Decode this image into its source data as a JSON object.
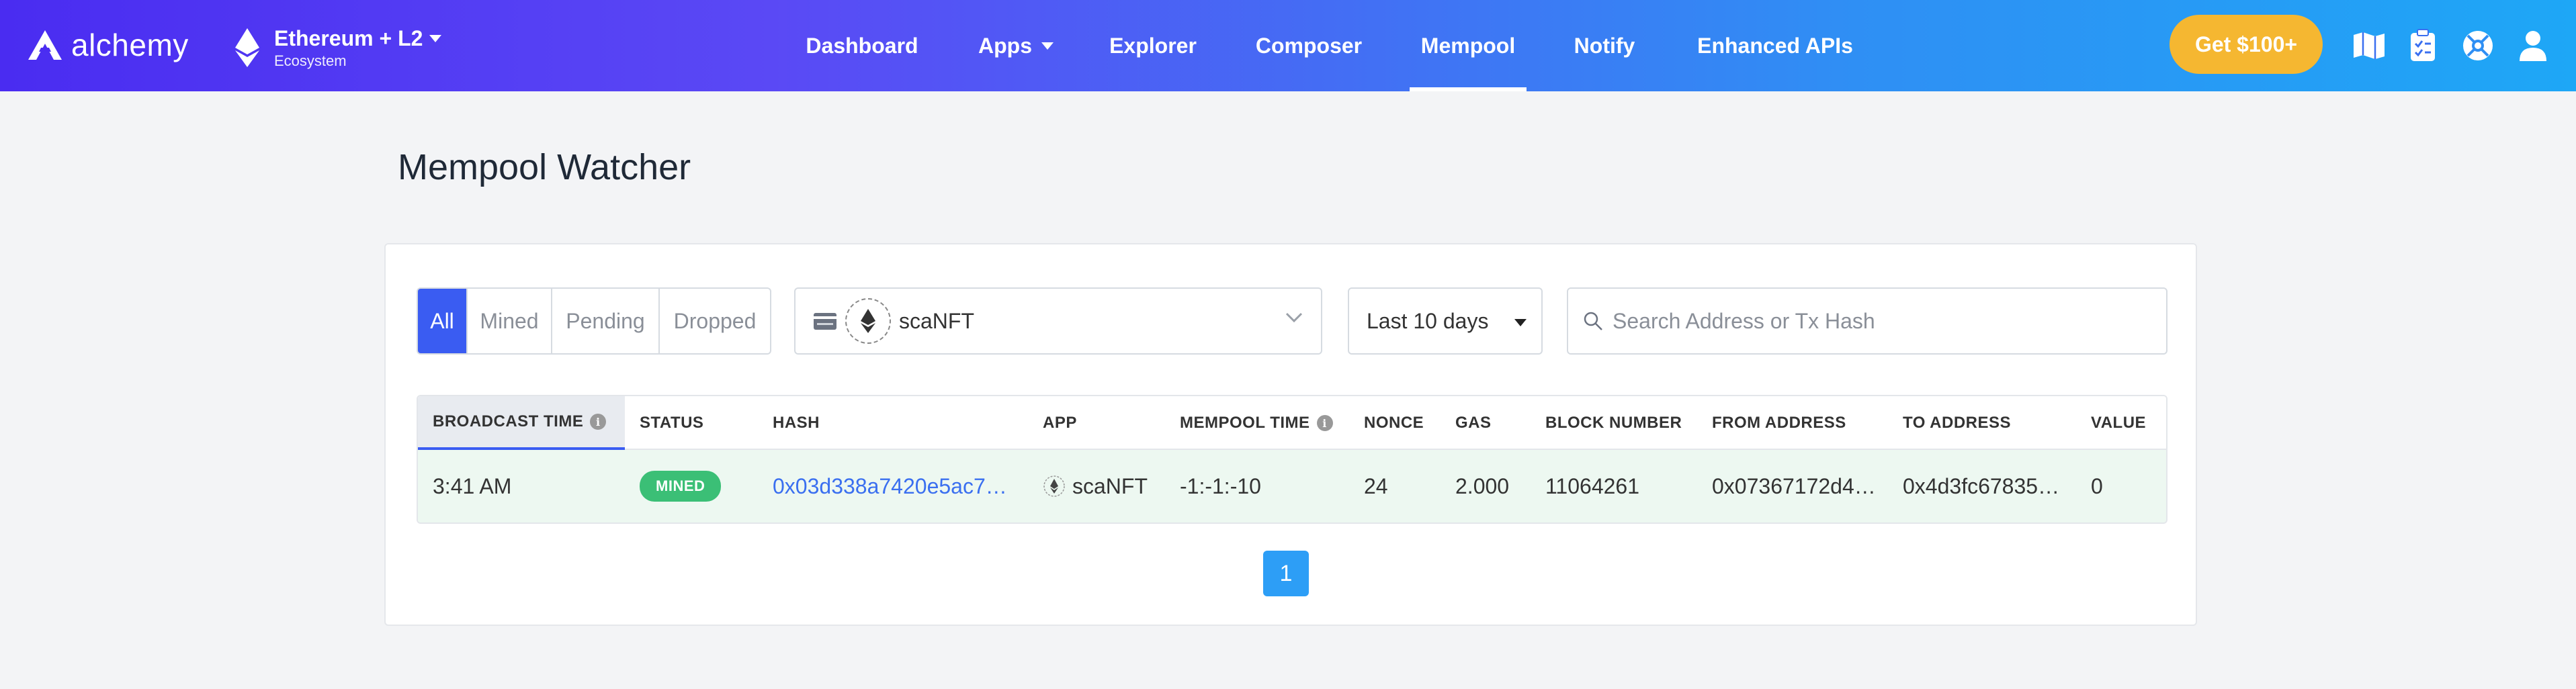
{
  "brand": {
    "name": "alchemy"
  },
  "network": {
    "name": "Ethereum + L2",
    "sub": "Ecosystem"
  },
  "nav": {
    "dashboard": "Dashboard",
    "apps": "Apps",
    "explorer": "Explorer",
    "composer": "Composer",
    "mempool": "Mempool",
    "notify": "Notify",
    "enhanced": "Enhanced APIs",
    "active": "Mempool"
  },
  "cta": {
    "label": "Get $100+"
  },
  "toolbar_icons": [
    "map-icon",
    "clipboard-icon",
    "support-icon",
    "user-icon"
  ],
  "page": {
    "title": "Mempool Watcher"
  },
  "filters": {
    "status_tabs": [
      "All",
      "Mined",
      "Pending",
      "Dropped"
    ],
    "active_status": "All",
    "app_select": "scaNFT",
    "range_select": "Last 10 days",
    "search_placeholder": "Search Address or Tx Hash"
  },
  "table": {
    "columns": [
      "BROADCAST TIME",
      "STATUS",
      "HASH",
      "APP",
      "MEMPOOL TIME",
      "NONCE",
      "GAS",
      "BLOCK NUMBER",
      "FROM ADDRESS",
      "TO ADDRESS",
      "VALUE"
    ],
    "sorted_column": "BROADCAST TIME",
    "rows": [
      {
        "broadcast_time": "3:41 AM",
        "status": "MINED",
        "hash": "0x03d338a7420e5ac7…",
        "app": "scaNFT",
        "mempool_time": "-1:-1:-10",
        "nonce": "24",
        "gas": "2.000",
        "block_number": "11064261",
        "from_address": "0x07367172d4…",
        "to_address": "0x4d3fc67835…",
        "value": "0"
      }
    ]
  },
  "pagination": {
    "current": "1"
  },
  "colors": {
    "accent": "#3a5cf2",
    "mined": "#3bbf76",
    "cta": "#f5b731",
    "link": "#3a6ff0"
  }
}
